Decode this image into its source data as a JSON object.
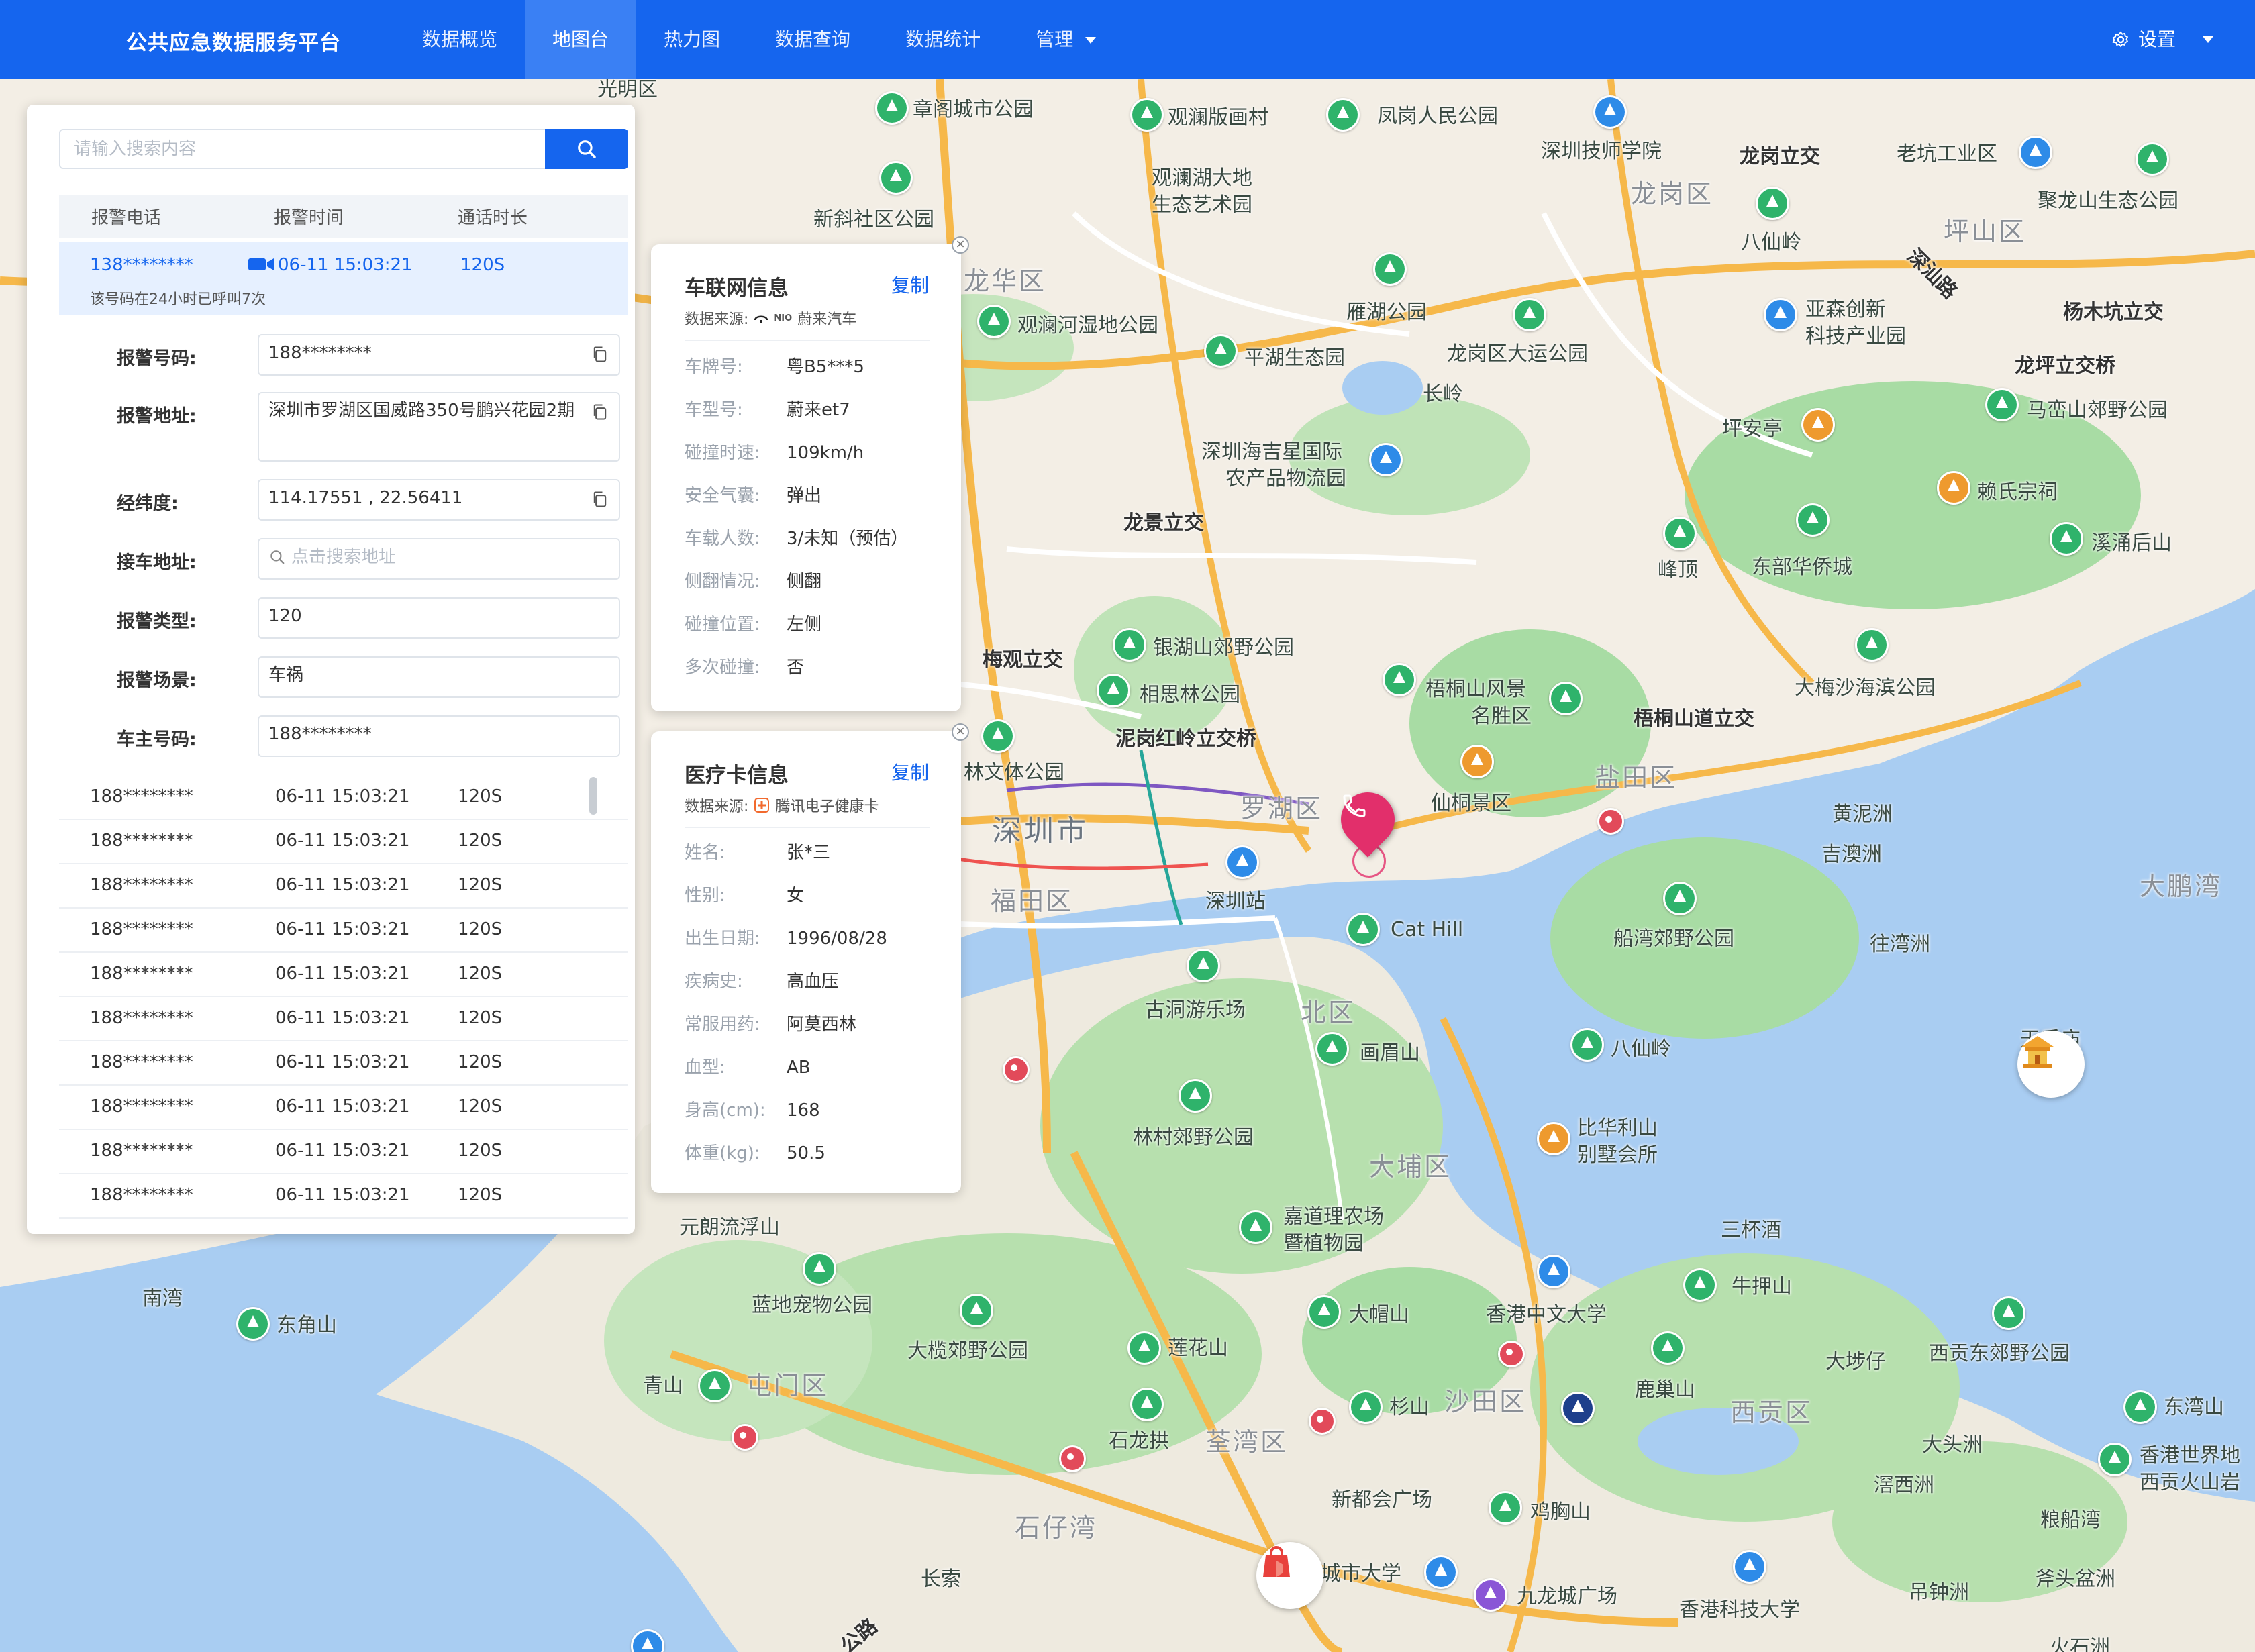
{
  "nav": {
    "brand": "公共应急数据服务平台",
    "items": [
      {
        "label": "数据概览"
      },
      {
        "label": "地图台"
      },
      {
        "label": "热力图"
      },
      {
        "label": "数据查询"
      },
      {
        "label": "数据统计"
      },
      {
        "label": "管理"
      }
    ],
    "active_index": 1,
    "settings_label": "设置"
  },
  "colors": {
    "primary": "#1565ee",
    "alarm": "#e22f6b",
    "park": "#2fb36b"
  },
  "search": {
    "placeholder": "请输入搜索内容"
  },
  "table": {
    "headers": [
      "报警电话",
      "报警时间",
      "通话时长"
    ],
    "selected": {
      "phone": "138********",
      "time": "06-11 15:03:21",
      "duration": "120S",
      "note": "该号码在24小时已呼叫7次",
      "icon": "video-icon"
    },
    "rows": [
      {
        "phone": "188********",
        "time": "06-11 15:03:21",
        "duration": "120S"
      },
      {
        "phone": "188********",
        "time": "06-11 15:03:21",
        "duration": "120S"
      },
      {
        "phone": "188********",
        "time": "06-11 15:03:21",
        "duration": "120S"
      },
      {
        "phone": "188********",
        "time": "06-11 15:03:21",
        "duration": "120S"
      },
      {
        "phone": "188********",
        "time": "06-11 15:03:21",
        "duration": "120S"
      },
      {
        "phone": "188********",
        "time": "06-11 15:03:21",
        "duration": "120S"
      },
      {
        "phone": "188********",
        "time": "06-11 15:03:21",
        "duration": "120S"
      },
      {
        "phone": "188********",
        "time": "06-11 15:03:21",
        "duration": "120S"
      },
      {
        "phone": "188********",
        "time": "06-11 15:03:21",
        "duration": "120S"
      },
      {
        "phone": "188********",
        "time": "06-11 15:03:21",
        "duration": "120S"
      }
    ]
  },
  "form": {
    "phone": {
      "label": "报警号码:",
      "value": "188********"
    },
    "address": {
      "label": "报警地址:",
      "value": "深圳市罗湖区国威路350号鹏兴花园2期"
    },
    "coords": {
      "label": "经纬度:",
      "value": "114.17551 , 22.56411"
    },
    "pickup": {
      "label": "接车地址:",
      "placeholder": "点击搜索地址"
    },
    "type": {
      "label": "报警类型:",
      "value": "120"
    },
    "scene": {
      "label": "报警场景:",
      "value": "车祸"
    },
    "owner": {
      "label": "车主号码:",
      "value": "188********"
    }
  },
  "vehicle_card": {
    "title": "车联网信息",
    "copy": "复制",
    "source_label": "数据来源:",
    "source_logo": "NIO",
    "source_name": "蔚来汽车",
    "rows": [
      {
        "k": "车牌号:",
        "v": "粤B5***5"
      },
      {
        "k": "车型号:",
        "v": "蔚来et7"
      },
      {
        "k": "碰撞时速:",
        "v": "109km/h"
      },
      {
        "k": "安全气囊:",
        "v": "弹出"
      },
      {
        "k": "车载人数:",
        "v": "3/未知（预估）"
      },
      {
        "k": "侧翻情况:",
        "v": "侧翻"
      },
      {
        "k": "碰撞位置:",
        "v": "左侧"
      },
      {
        "k": "多次碰撞:",
        "v": "否"
      }
    ]
  },
  "medical_card": {
    "title": "医疗卡信息",
    "copy": "复制",
    "source_label": "数据来源:",
    "source_name": "腾讯电子健康卡",
    "rows": [
      {
        "k": "姓名:",
        "v": "张*三"
      },
      {
        "k": "性别:",
        "v": "女"
      },
      {
        "k": "出生日期:",
        "v": "1996/08/28"
      },
      {
        "k": "疾病史:",
        "v": "高血压"
      },
      {
        "k": "常服用药:",
        "v": "阿莫西林"
      },
      {
        "k": "血型:",
        "v": "AB"
      },
      {
        "k": "身高(cm):",
        "v": "168"
      },
      {
        "k": "体重(kg):",
        "v": "50.5"
      }
    ]
  },
  "map": {
    "labels": {
      "guangming": "光明区",
      "zhangge": "章阁城市公园",
      "guanlan_print": "观澜版画村",
      "fenggang": "凤岗人民公园",
      "jishi": "深圳技师学院",
      "longgang_jc": "龙岗立交",
      "laokeng": "老坑工业区",
      "guanlanhu": "观澜湖大地",
      "guanlanhu2": "生态艺术园",
      "longgang": "龙岗区",
      "xinxie": "新斜社区公园",
      "baxianling": "八仙岭",
      "pingshan": "坪山区",
      "julong": "聚龙山生态公园",
      "longhua": "龙华区",
      "guanlan_wet": "观澜河湿地公园",
      "yanhu": "雁湖公园",
      "yasen": "亚森创新",
      "yasen2": "科技产业园",
      "yangmukeng": "杨木坑立交",
      "pinghu": "平湖生态园",
      "dayun": "龙岗区大运公园",
      "longping": "龙坪立交桥",
      "mashan": "马峦山郊野公园",
      "haijixing": "深圳海吉星国际",
      "haijixing2": "农产品物流园",
      "pingan": "坪安亭",
      "laishi": "赖氏宗祠",
      "longjing": "龙景立交",
      "changling": "长岭",
      "feng": "峰顶",
      "dongbu": "东部华侨城",
      "xichong": "溪涌后山",
      "yinhu": "银湖山郊野公园",
      "meiguan": "梅观立交",
      "xiangsi": "相思林公园",
      "wutong": "梧桐山风景",
      "wutong2": "名胜区",
      "wutongdao": "梧桐山道立交",
      "dameisha": "大梅沙海滨公园",
      "nigang": "泥岗红岭立交桥",
      "lin": "林文体公园",
      "luohu": "罗湖区",
      "xiantong": "仙桐景区",
      "yantian": "盐田区",
      "shenzhen": "深圳市",
      "huangni": "黄泥洲",
      "jiao": "吉澳洲",
      "dapeng": "大鹏湾",
      "futian": "福田区",
      "shenzhenzhan": "深圳站",
      "cathill": "Cat Hill",
      "chuanwan": "船湾郊野公园",
      "wangzhou": "往湾洲",
      "gudong": "古洞游乐场",
      "beiqu": "北区",
      "huamei": "画眉山",
      "baxian2": "八仙岭",
      "tianhou": "天后庙",
      "linshun": "林村郊野公园",
      "bihuali": "比华利山",
      "bihuali2": "别墅会所",
      "dapu": "大埔区",
      "yuanlang": "元朗流浮山",
      "jiadao": "嘉道理农场",
      "jiadao2": "暨植物园",
      "sanbei": "三杯酒",
      "nanwan": "南湾",
      "dongjiao": "东角山",
      "landi": "蓝地宠物公园",
      "niuya": "牛押山",
      "damao": "大帽山",
      "zhongda": "香港中文大学",
      "dalan": "大榄郊野公园",
      "lianhua": "莲花山",
      "lugao": "鹿巢山",
      "dayu": "大埗仔",
      "xigong": "西贡东郊野公园",
      "qingshan": "青山",
      "tunmen": "屯门区",
      "shanshan": "杉山",
      "shatian": "沙田区",
      "xigongqu": "西贡区",
      "dongwan": "东湾山",
      "shilong": "石龙拱",
      "quanwan": "荃湾区",
      "datou": "大头洲",
      "xianggang_geo": "香港世界地",
      "xianggang_geo2": "西贡火山岩",
      "xinduhui": "新都会广场",
      "jixiong": "鸡胸山",
      "youxi": "滘西洲",
      "liangchuan": "粮船湾",
      "shizai": "石仔湾",
      "xgcity": "香港城市大学",
      "jiulong": "九龙城广场",
      "kejida": "香港科技大学",
      "diaozhong": "吊钟洲",
      "futou": "斧头盆洲",
      "changsuo": "长索",
      "huoshi": "火石洲",
      "shenshan": "深汕路",
      "gong_lu": "公路"
    }
  }
}
